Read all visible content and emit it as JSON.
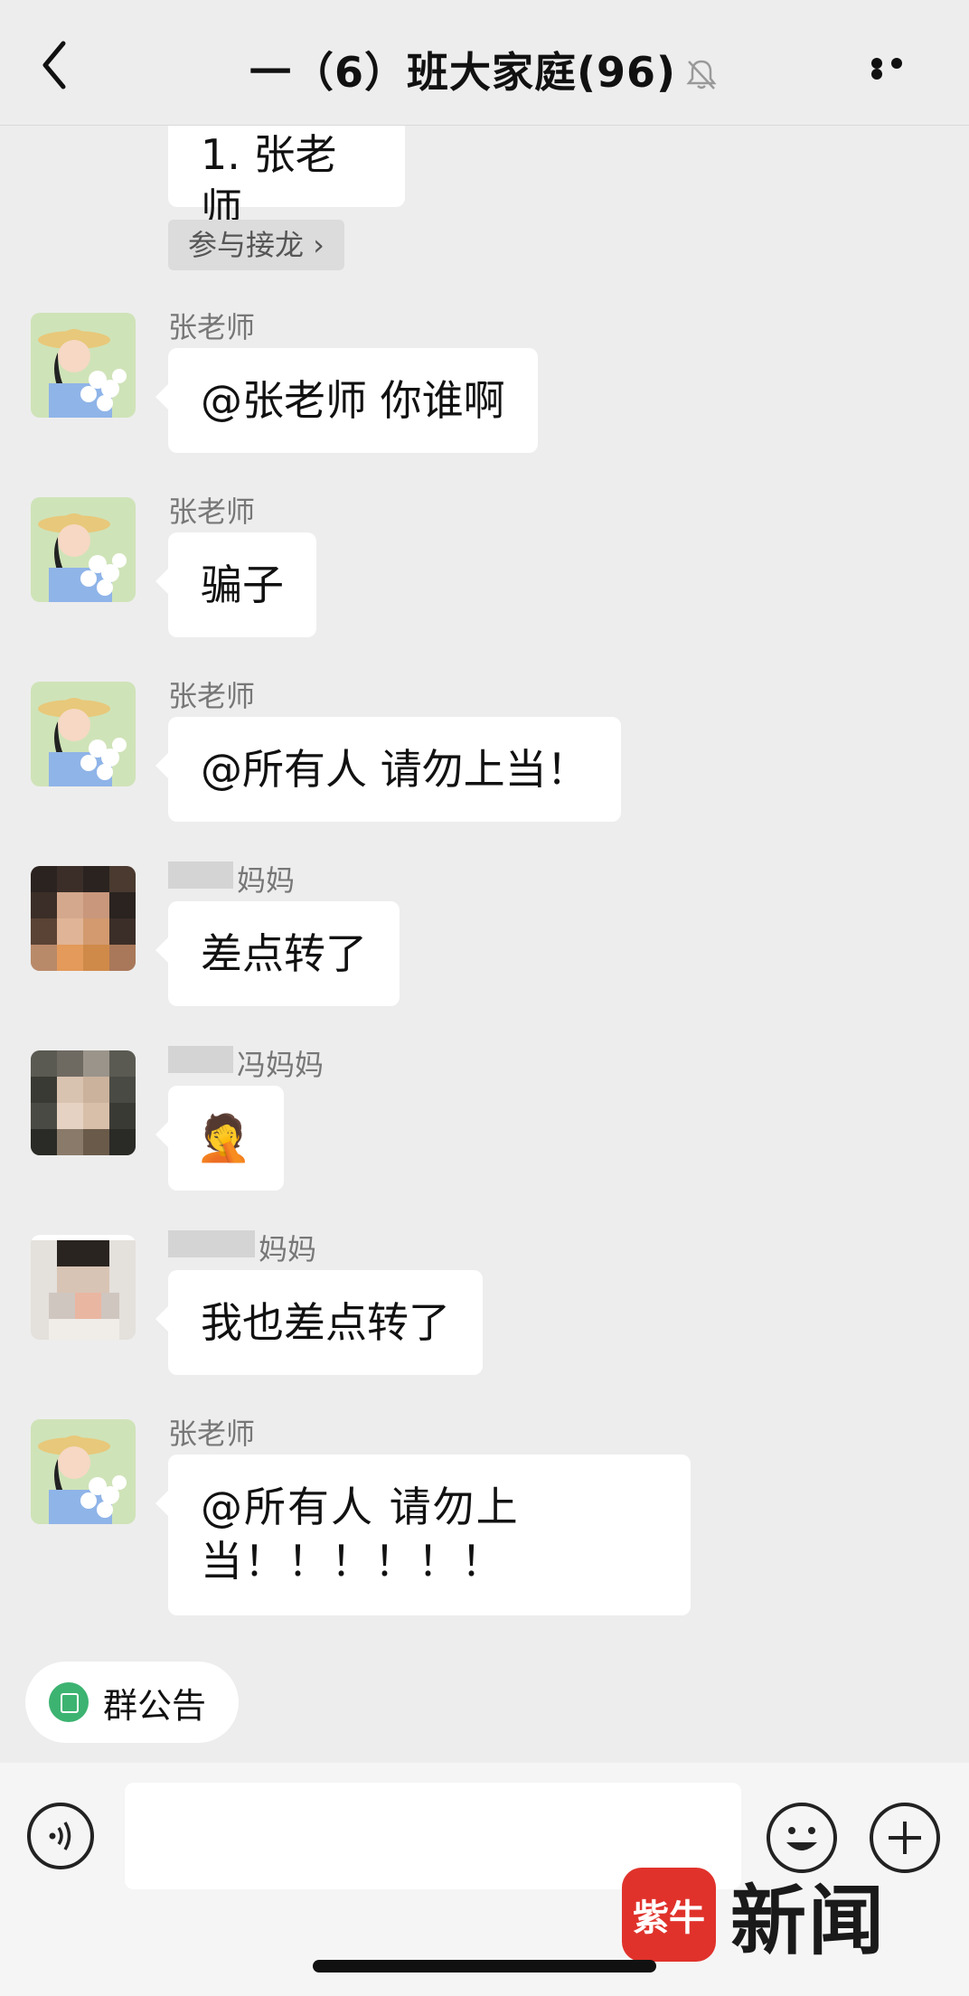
{
  "header": {
    "title": "一（6）班大家庭(96)",
    "icons": {
      "back": "back-chevron-icon",
      "mute": "bell-muted-icon",
      "more": "more-dots-icon"
    }
  },
  "chat": {
    "partial_bubble_text": "1. 张老师",
    "join_label": "参与接龙 ›",
    "messages": [
      {
        "sender": "张老师",
        "text": "@张老师  你谁啊"
      },
      {
        "sender": "张老师",
        "text": "骗子"
      },
      {
        "sender": "张老师",
        "text": "@所有人  请勿上当！"
      },
      {
        "sender": "妈妈",
        "text": "差点转了"
      },
      {
        "sender": "冯妈妈",
        "text": "",
        "emoji": "🤦"
      },
      {
        "sender": "妈妈",
        "text": "我也差点转了"
      },
      {
        "sender": "张老师",
        "text": "@所有人  请勿上当！！！！！！"
      }
    ]
  },
  "announcement": {
    "label": "群公告"
  },
  "input_bar": {
    "placeholder": "",
    "icons": {
      "voice": "voice-icon",
      "emoji": "emoji-icon",
      "plus": "plus-icon"
    }
  },
  "watermark": {
    "logo_text": "紫牛",
    "text": "新闻"
  },
  "colors": {
    "bg": "#ededed",
    "bubble": "#ffffff",
    "accent_green": "#3cb371",
    "brand_red": "#e0322b"
  }
}
